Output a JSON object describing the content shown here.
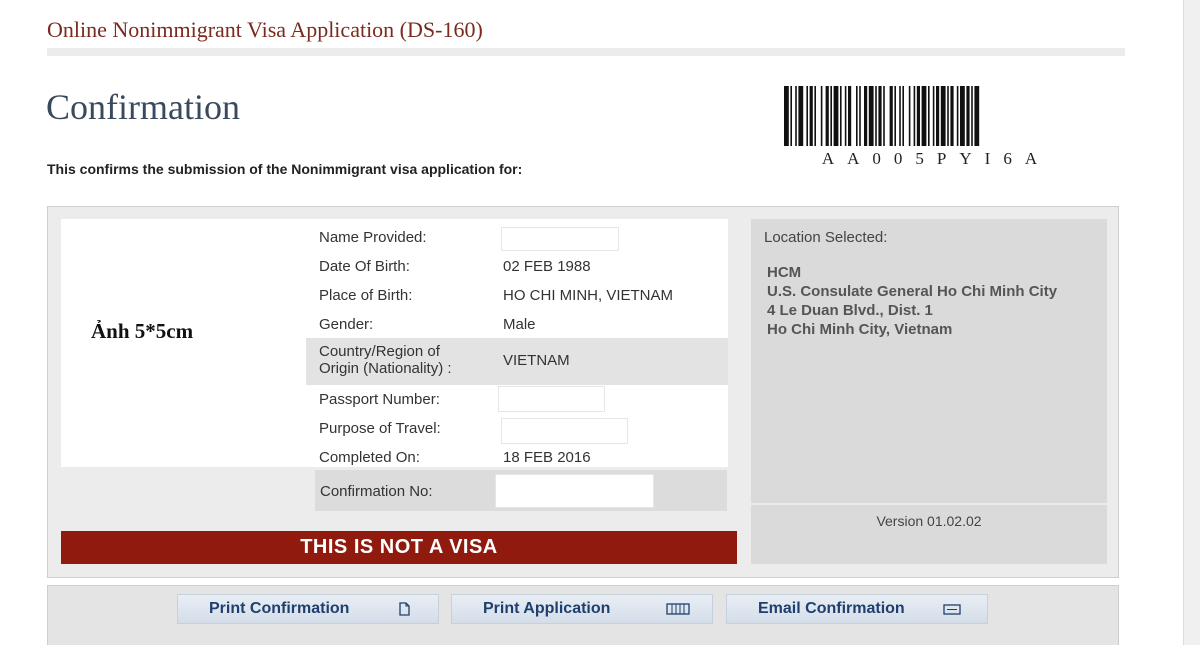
{
  "header": {
    "app_title": "Online Nonimmigrant Visa Application (DS-160)"
  },
  "page": {
    "title": "Confirmation",
    "intro": "This confirms the submission of the Nonimmigrant visa application for:",
    "barcode_text": "AA005PYI6A"
  },
  "photo": {
    "label": "Ảnh 5*5cm"
  },
  "details": {
    "name_label": "Name Provided:",
    "dob_label": "Date Of Birth:",
    "dob_value": "02 FEB 1988",
    "pob_label": "Place of Birth:",
    "pob_value": "HO CHI MINH, VIETNAM",
    "gender_label": "Gender:",
    "gender_value": "Male",
    "country_label_1": "Country/Region of",
    "country_label_2": "Origin (Nationality) :",
    "country_value": "VIETNAM",
    "passport_label": "Passport Number:",
    "purpose_label": "Purpose of Travel:",
    "completed_label": "Completed On:",
    "completed_value": "18 FEB 2016",
    "confirmation_label": "Confirmation No:"
  },
  "banner": {
    "not_visa": "THIS IS NOT A VISA"
  },
  "location": {
    "header": "Location Selected:",
    "line1": "HCM",
    "line2": "U.S. Consulate General Ho Chi Minh City",
    "line3": "4 Le Duan Blvd., Dist. 1",
    "line4": "Ho Chi Minh City, Vietnam"
  },
  "version": "Version 01.02.02",
  "buttons": {
    "print_confirmation": "Print Confirmation",
    "print_application": "Print Application",
    "email_confirmation": "Email Confirmation"
  },
  "icons": {
    "print_confirmation": "document-icon",
    "print_application": "pages-icon",
    "email_confirmation": "envelope-icon"
  }
}
